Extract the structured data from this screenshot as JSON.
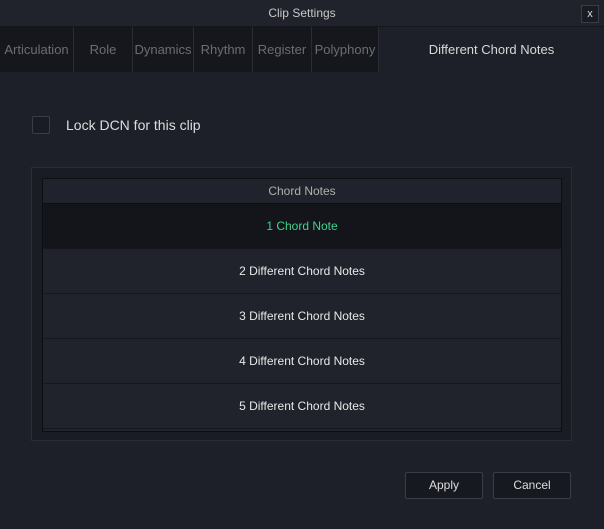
{
  "window": {
    "title": "Clip Settings",
    "close_label": "x"
  },
  "tabs": [
    {
      "label": "Articulation"
    },
    {
      "label": "Role"
    },
    {
      "label": "Dynamics"
    },
    {
      "label": "Rhythm"
    },
    {
      "label": "Register"
    },
    {
      "label": "Polyphony"
    },
    {
      "label": "Different Chord Notes",
      "active": true
    }
  ],
  "lock": {
    "label": "Lock DCN for this clip",
    "checked": false
  },
  "table": {
    "header": "Chord Notes",
    "rows": [
      {
        "label": "1 Chord Note",
        "selected": true
      },
      {
        "label": "2 Different Chord Notes"
      },
      {
        "label": "3 Different Chord Notes"
      },
      {
        "label": "4 Different Chord Notes"
      },
      {
        "label": "5 Different Chord Notes"
      }
    ]
  },
  "buttons": {
    "apply": "Apply",
    "cancel": "Cancel"
  },
  "colors": {
    "selected_text": "#3fd38c"
  }
}
